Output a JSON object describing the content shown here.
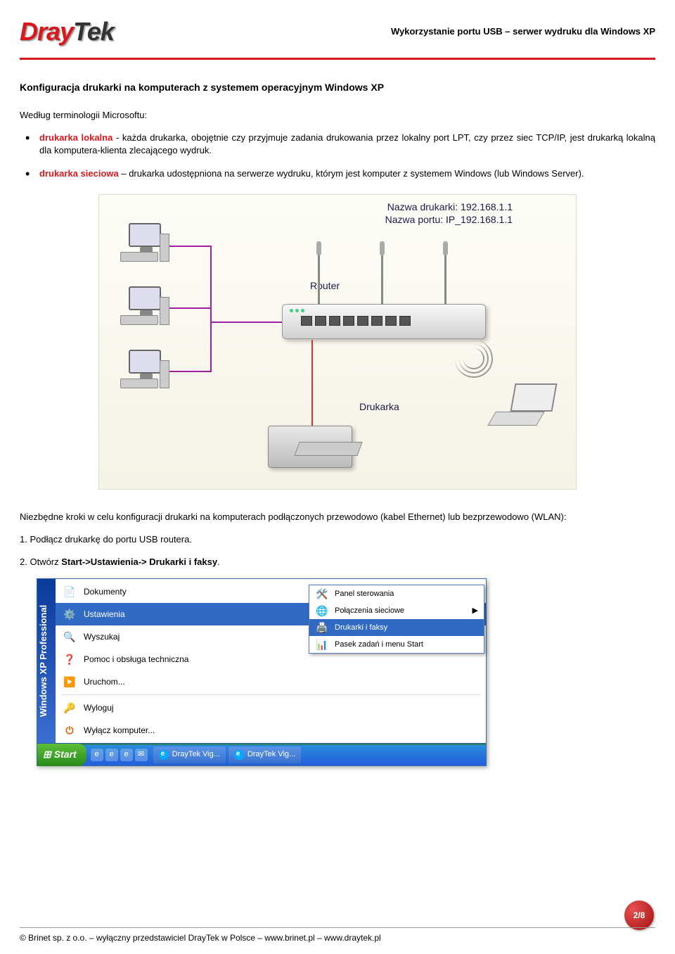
{
  "header": {
    "logo_main": "Dray",
    "logo_suffix": "Tek",
    "title": "Wykorzystanie portu USB – serwer wydruku dla Windows XP"
  },
  "content": {
    "h1": "Konfiguracja drukarki na komputerach z systemem operacyjnym Windows XP",
    "intro": "Według terminologii Microsoftu:",
    "bullet1_term": "drukarka lokalna",
    "bullet1_rest": " - każda drukarka, obojętnie czy przyjmuje zadania drukowania przez lokalny port LPT, czy przez siec TCP/IP, jest drukarką lokalną dla komputera-klienta zlecającego wydruk.",
    "bullet2_term": "drukarka sieciowa",
    "bullet2_rest": " – drukarka udostępniona na serwerze wydruku, którym jest komputer z systemem Windows (lub Windows Server).",
    "diagram": {
      "name_label": "Nazwa drukarki: 192.168.1.1",
      "port_label": "Nazwa portu: IP_192.168.1.1",
      "router_label": "Router",
      "printer_label": "Drukarka"
    },
    "steps_intro": "Niezbędne kroki w celu konfiguracji drukarki na komputerach podłączonych przewodowo (kabel Ethernet) lub bezprzewodowo (WLAN):",
    "step1": "1. Podłącz drukarkę do portu USB routera.",
    "step2_pre": "2. Otwórz ",
    "step2_bold": "Start->Ustawienia-> Drukarki i faksy",
    "step2_post": "."
  },
  "startmenu": {
    "sidebar": "Windows XP  Professional",
    "items": [
      {
        "icon": "icon-doc",
        "label": "Dokumenty",
        "arrow": true
      },
      {
        "icon": "icon-gear",
        "label": "Ustawienia",
        "arrow": true,
        "active": true
      },
      {
        "icon": "icon-search",
        "label": "Wyszukaj",
        "arrow": true
      },
      {
        "icon": "icon-help",
        "label": "Pomoc i obsługa techniczna"
      },
      {
        "icon": "icon-run",
        "label": "Uruchom..."
      },
      {
        "sep": true
      },
      {
        "icon": "icon-logoff",
        "label": "Wyloguj"
      },
      {
        "icon": "icon-power",
        "label": "Wyłącz komputer..."
      }
    ],
    "submenu": [
      {
        "icon": "icon-cp",
        "label": "Panel sterowania"
      },
      {
        "icon": "icon-net",
        "label": "Połączenia sieciowe",
        "arrow": true
      },
      {
        "icon": "icon-print",
        "label": "Drukarki i faksy",
        "active": true
      },
      {
        "icon": "icon-taskbar",
        "label": "Pasek zadań i menu Start"
      }
    ],
    "start_label": "Start",
    "task1": "DrayTek Vig...",
    "task2": "DrayTek Vig..."
  },
  "footer": {
    "text": "© Brinet sp. z o.o. – wyłączny przedstawiciel DrayTek w Polsce – www.brinet.pl – www.draytek.pl",
    "page": "2/8"
  }
}
